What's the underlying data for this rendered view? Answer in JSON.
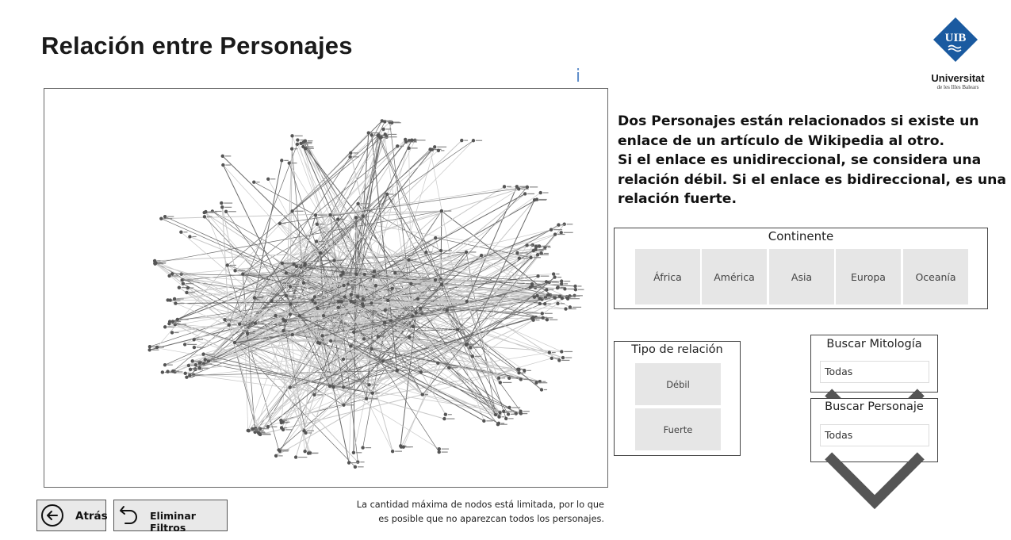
{
  "page_title": "Relación entre Personajes",
  "info_icon": "i",
  "logo": {
    "monogram": "UIB",
    "name": "Universitat",
    "subtitle": "de les Illes Balears",
    "color": "#1a5aa0"
  },
  "description": [
    "Dos Personajes están relacionados si existe un",
    "enlace de un artículo de Wikipedia al otro.",
    "Si el enlace es unidireccional, se considera una",
    "relación débil. Si el enlace es bidireccional, es una",
    "relación fuerte."
  ],
  "continent_slicer": {
    "title": "Continente",
    "options": [
      "África",
      "América",
      "Asia",
      "Europa",
      "Oceanía"
    ]
  },
  "relation_slicer": {
    "title": "Tipo de relación",
    "options": [
      "Débil",
      "Fuerte"
    ]
  },
  "mythology_search": {
    "title": "Buscar Mitología",
    "value": "Todas"
  },
  "character_search": {
    "title": "Buscar Personaje",
    "value": "Todas"
  },
  "buttons": {
    "back": "Atrás",
    "clear_filters": "Eliminar Filtros"
  },
  "note": [
    "La cantidad máxima de nodos está limitada, por lo que",
    "es posible que no aparezcan todos los personajes."
  ],
  "icons": {
    "back": "arrow-left-circle-icon",
    "clear": "undo-arrow-icon",
    "dropdown": "chevron-down-icon",
    "info": "info-icon"
  }
}
